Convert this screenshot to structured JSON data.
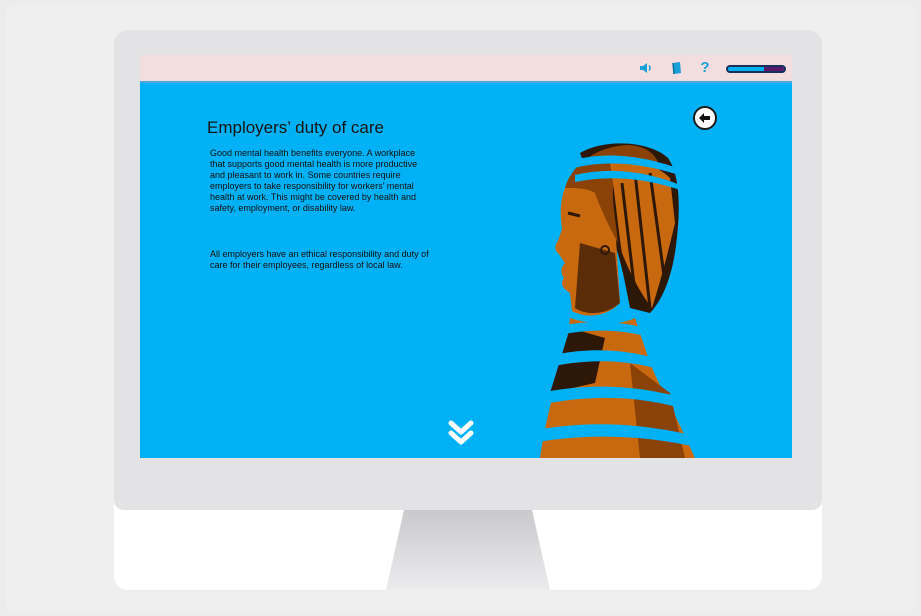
{
  "header": {
    "icons": [
      "speaker-icon",
      "book-icon",
      "help-icon"
    ],
    "help_glyph": "?",
    "progress": 0.35
  },
  "content": {
    "title": "Employers’ duty of care",
    "paragraphs": [
      "Good mental health benefits everyone. A workplace that supports good mental health is more productive and pleasant to work in. Some countries require employers to take responsibility for workers’ mental health at work. This might be covered by health and safety, employment, or disability law.",
      "All employers have an ethical responsibility and duty of care for their employees, regardless of local law."
    ]
  },
  "colors": {
    "screen_bg": "#00b2f5",
    "topbar_bg": "#f2dede",
    "skin": "#c8690f",
    "shadow": "#2d1706",
    "accent_purple": "#5a1a6b"
  }
}
